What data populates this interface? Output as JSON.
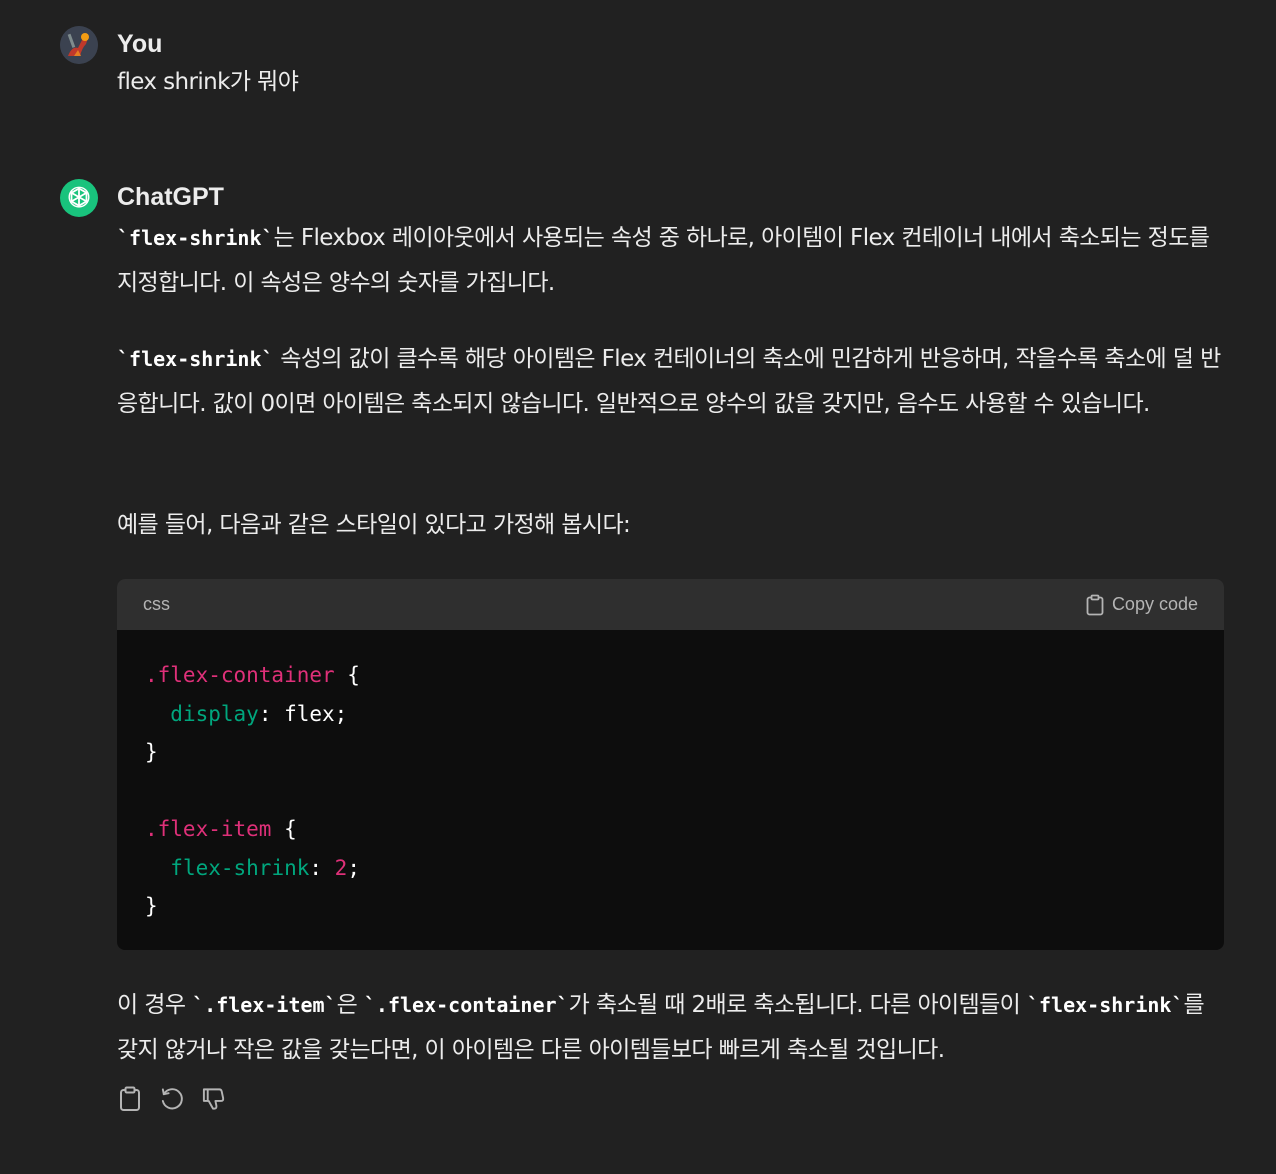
{
  "user_message": {
    "author": "You",
    "text": "flex shrink가 뭐야"
  },
  "assistant_message": {
    "author": "ChatGPT",
    "p1": {
      "code1": "`flex-shrink`",
      "text1": "는 Flexbox 레이아웃에서 사용되는 속성 중 하나로, 아이템이 Flex 컨테이너 내에서 축소되는 정도를 지정합니다. 이 속성은 양수의 숫자를 가집니다."
    },
    "p2": {
      "code1": "`flex-shrink`",
      "text1": " 속성의 값이 클수록 해당 아이템은 Flex 컨테이너의 축소에 민감하게 반응하며, 작을수록 축소에 덜 반응합니다. 값이 0이면 아이템은 축소되지 않습니다. 일반적으로 양수의 값을 갖지만, 음수도 사용할 수 있습니다."
    },
    "p3": {
      "text": "예를 들어, 다음과 같은 스타일이 있다고 가정해 봅시다:"
    },
    "code_block": {
      "language": "css",
      "copy_label": "Copy code",
      "lines": [
        [
          {
            "t": ".flex-container",
            "c": "sel"
          },
          {
            "t": " {",
            "c": ""
          }
        ],
        [
          {
            "t": "  ",
            "c": ""
          },
          {
            "t": "display",
            "c": "prop"
          },
          {
            "t": ": flex;",
            "c": ""
          }
        ],
        [
          {
            "t": "}",
            "c": ""
          }
        ],
        [
          {
            "t": "",
            "c": ""
          }
        ],
        [
          {
            "t": ".flex-item",
            "c": "sel"
          },
          {
            "t": " {",
            "c": ""
          }
        ],
        [
          {
            "t": "  ",
            "c": ""
          },
          {
            "t": "flex-shrink",
            "c": "prop"
          },
          {
            "t": ": ",
            "c": ""
          },
          {
            "t": "2",
            "c": "num"
          },
          {
            "t": ";",
            "c": ""
          }
        ],
        [
          {
            "t": "}",
            "c": ""
          }
        ]
      ]
    },
    "p4": {
      "text1": "이 경우 ",
      "code1": "`.flex-item`",
      "text2": "은 ",
      "code2": "`.flex-container`",
      "text3": "가 축소될 때 2배로 축소됩니다. 다른 아이템들이 ",
      "code3": "`flex-shrink`",
      "text4": "를 갖지 않거나 작은 값을 갖는다면, 이 아이템은 다른 아이템들보다 빠르게 축소될 것입니다."
    },
    "actions": [
      "clipboard-icon",
      "regenerate-icon",
      "thumbs-down-icon"
    ]
  },
  "colors": {
    "background": "#212121",
    "text": "#ececec",
    "code_header": "#2f2f2f",
    "code_bg": "#0d0d0d",
    "selector": "#df3079",
    "property": "#00a67d",
    "gpt_avatar": "#19c37d"
  }
}
